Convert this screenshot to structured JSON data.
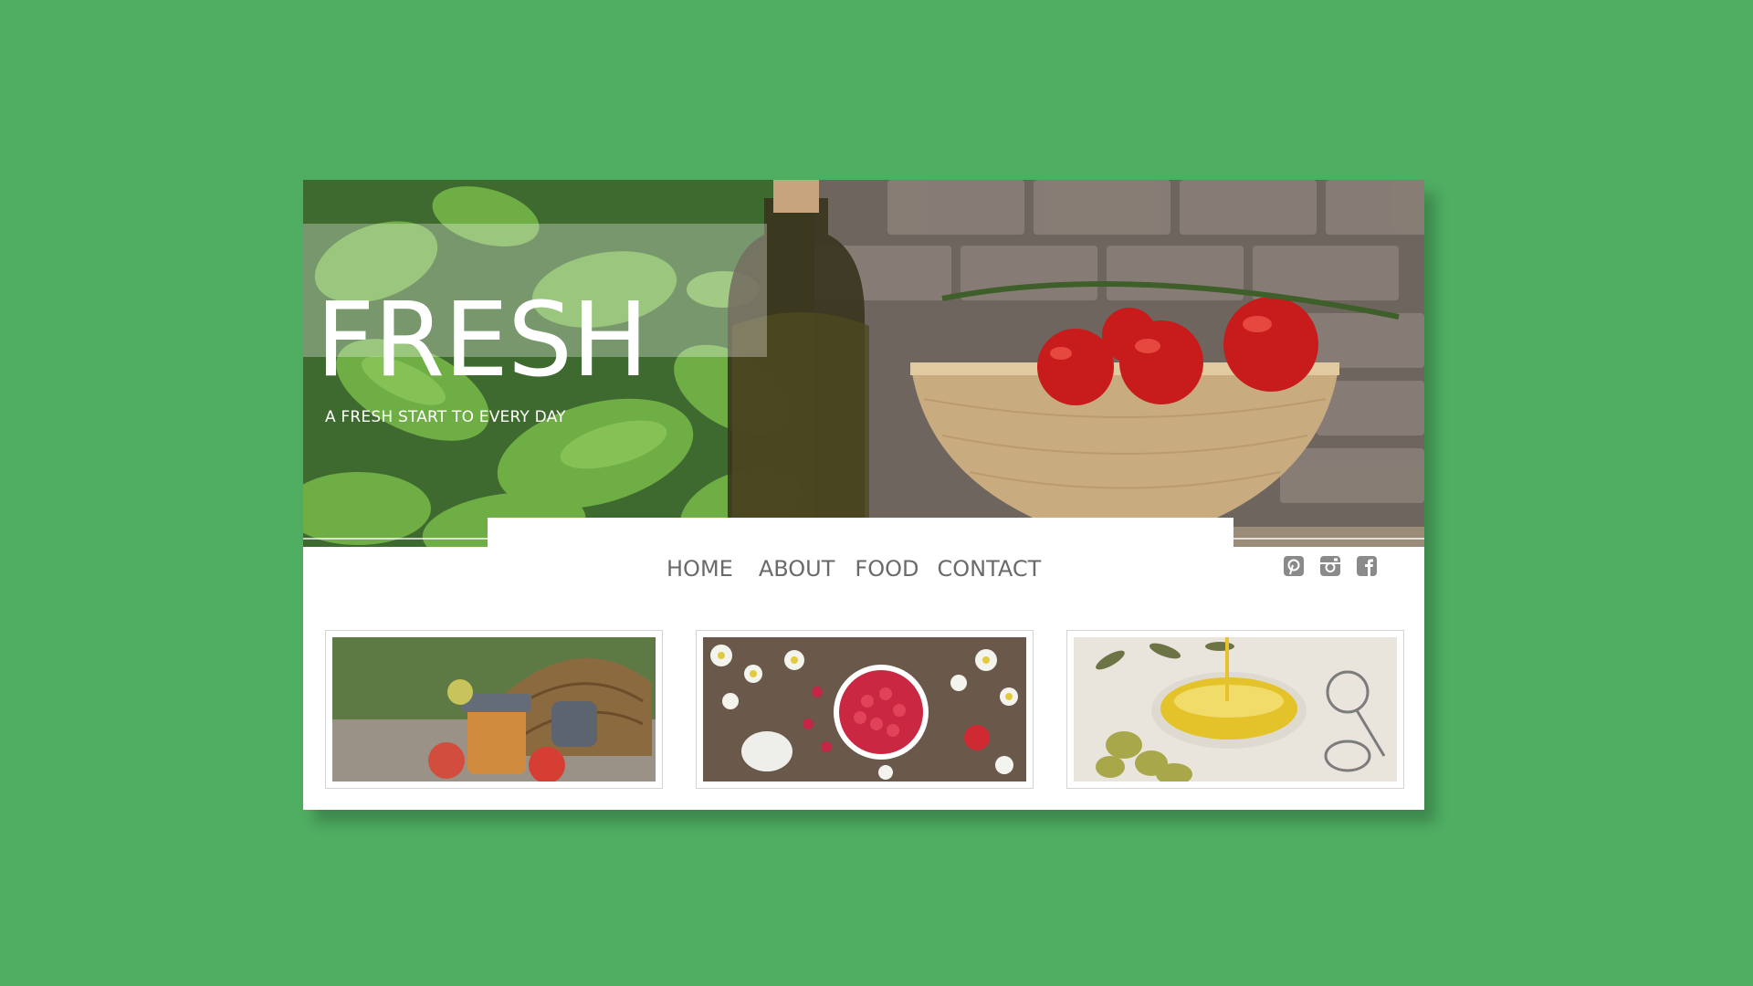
{
  "hero": {
    "title": "FRESH",
    "tagline": "A FRESH START TO EVERY DAY"
  },
  "nav": {
    "items": [
      {
        "label": "HOME"
      },
      {
        "label": "ABOUT"
      },
      {
        "label": "FOOD"
      },
      {
        "label": "CONTACT"
      }
    ]
  },
  "social": [
    {
      "icon": "pinterest-icon"
    },
    {
      "icon": "instagram-icon"
    },
    {
      "icon": "facebook-icon"
    }
  ],
  "gallery": [
    {
      "icon": "basket-jam-apples-image"
    },
    {
      "icon": "raspberries-flowers-image"
    },
    {
      "icon": "olive-oil-bowl-image"
    }
  ],
  "colors": {
    "background": "#4fae62",
    "card": "#ffffff",
    "nav_text": "#6a6a6a",
    "icon": "#8a8a8a"
  }
}
